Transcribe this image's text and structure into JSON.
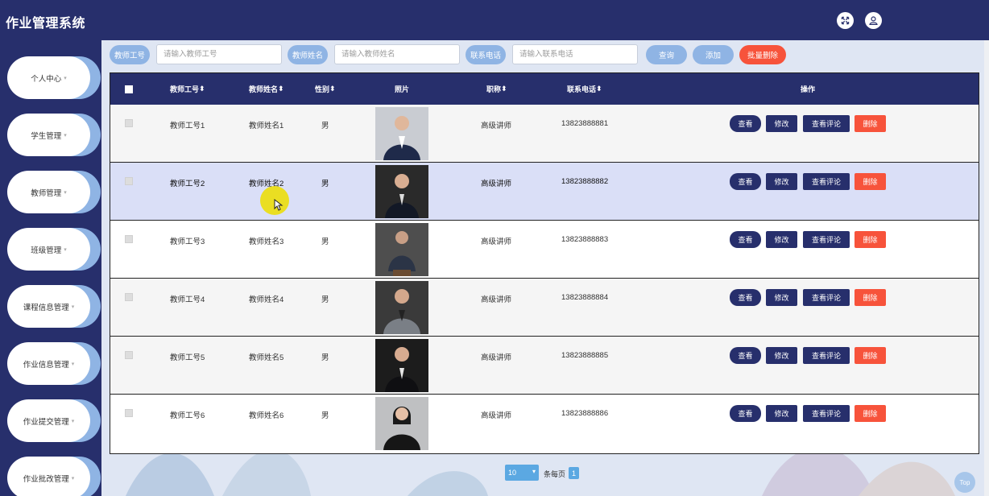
{
  "app": {
    "title": "作业管理系统"
  },
  "header": {
    "icons": [
      "fullscreen-icon",
      "user-icon"
    ]
  },
  "sidebar": {
    "items": [
      {
        "label": "个人中心"
      },
      {
        "label": "学生管理"
      },
      {
        "label": "教师管理"
      },
      {
        "label": "班级管理"
      },
      {
        "label": "课程信息管理"
      },
      {
        "label": "作业信息管理"
      },
      {
        "label": "作业提交管理"
      },
      {
        "label": "作业批改管理"
      }
    ],
    "caret": "▾"
  },
  "search": {
    "id_label": "教师工号",
    "id_placeholder": "请输入教师工号",
    "name_label": "教师姓名",
    "name_placeholder": "请输入教师姓名",
    "phone_label": "联系电话",
    "phone_placeholder": "请输入联系电话",
    "query_button": "查询",
    "add_button": "添加",
    "batch_delete_button": "批量删除"
  },
  "table": {
    "headers": {
      "id": "教师工号",
      "name": "教师姓名",
      "gender": "性别",
      "photo": "照片",
      "title": "职称",
      "phone": "联系电话",
      "actions": "操作"
    },
    "sort_glyph": "⬍",
    "rows": [
      {
        "id": "教师工号1",
        "name": "教师姓名1",
        "gender": "男",
        "title": "高级讲师",
        "phone": "13823888881"
      },
      {
        "id": "教师工号2",
        "name": "教师姓名2",
        "gender": "男",
        "title": "高级讲师",
        "phone": "13823888882"
      },
      {
        "id": "教师工号3",
        "name": "教师姓名3",
        "gender": "男",
        "title": "高级讲师",
        "phone": "13823888883"
      },
      {
        "id": "教师工号4",
        "name": "教师姓名4",
        "gender": "男",
        "title": "高级讲师",
        "phone": "13823888884"
      },
      {
        "id": "教师工号5",
        "name": "教师姓名5",
        "gender": "男",
        "title": "高级讲师",
        "phone": "13823888885"
      },
      {
        "id": "教师工号6",
        "name": "教师姓名6",
        "gender": "男",
        "title": "高级讲师",
        "phone": "13823888886"
      }
    ],
    "row_actions": {
      "view": "查看",
      "edit": "修改",
      "comments": "查看评论",
      "delete": "删除"
    }
  },
  "pagination": {
    "page_size": "10",
    "per_page_text": "条每页",
    "current_page": "1"
  },
  "back_to_top": "Top",
  "colors": {
    "primary": "#272f6c",
    "accent_blue": "#8fb4e4",
    "danger": "#f7533b",
    "pager_blue": "#5ba8e2",
    "highlight_row": "#dadff7"
  }
}
